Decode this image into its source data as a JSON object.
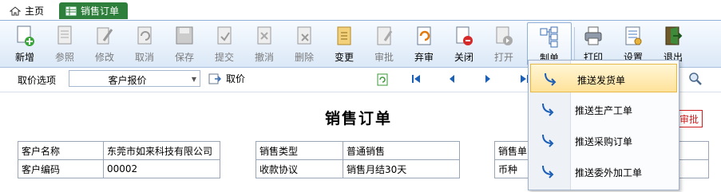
{
  "tabs": {
    "home": "主页",
    "active": "销售订单"
  },
  "toolbar": [
    {
      "key": "add",
      "label": "新增",
      "icon": "new-doc-icon",
      "enabled": true
    },
    {
      "key": "ref",
      "label": "参照",
      "icon": "reference-icon",
      "enabled": false
    },
    {
      "key": "edit",
      "label": "修改",
      "icon": "edit-icon",
      "enabled": false
    },
    {
      "key": "cancel",
      "label": "取消",
      "icon": "undo-icon",
      "enabled": false
    },
    {
      "key": "save",
      "label": "保存",
      "icon": "save-icon",
      "enabled": false
    },
    {
      "key": "submit",
      "label": "提交",
      "icon": "submit-icon",
      "enabled": false
    },
    {
      "key": "withdraw",
      "label": "撤消",
      "icon": "withdraw-icon",
      "enabled": false
    },
    {
      "key": "delete",
      "label": "删除",
      "icon": "delete-icon",
      "enabled": false
    },
    {
      "key": "change",
      "label": "变更",
      "icon": "change-icon",
      "enabled": true
    },
    {
      "key": "approve",
      "label": "审批",
      "icon": "approve-icon",
      "enabled": false
    },
    {
      "key": "unapprove",
      "label": "弃审",
      "icon": "unapprove-icon",
      "enabled": true
    },
    {
      "key": "close",
      "label": "关闭",
      "icon": "close-icon",
      "enabled": true
    },
    {
      "key": "open",
      "label": "打开",
      "icon": "open-icon",
      "enabled": false
    },
    {
      "key": "make",
      "label": "制单",
      "icon": "make-document-icon",
      "enabled": true
    },
    {
      "key": "print",
      "label": "打印",
      "icon": "printer-icon",
      "enabled": true
    },
    {
      "key": "settings",
      "label": "设置",
      "icon": "settings-icon",
      "enabled": true
    },
    {
      "key": "exit",
      "label": "退出",
      "icon": "exit-icon",
      "enabled": true
    }
  ],
  "options": {
    "label": "取价选项",
    "combo_value": "客户报价",
    "get_button": "取价"
  },
  "form": {
    "title": "销售订单",
    "status": "审批",
    "left": [
      {
        "label": "客户名称",
        "value": "东莞市如来科技有限公司"
      },
      {
        "label": "客户编码",
        "value": "00002"
      }
    ],
    "middle": [
      {
        "label": "销售类型",
        "value": "普通销售"
      },
      {
        "label": "收款协议",
        "value": "销售月结30天"
      }
    ],
    "right": [
      {
        "label": "销售单",
        "value": ""
      },
      {
        "label": "币种",
        "value": ""
      }
    ]
  },
  "menu": [
    {
      "label": "推送发货单",
      "highlighted": true
    },
    {
      "label": "推送生产工单",
      "highlighted": false
    },
    {
      "label": "推送采购订单",
      "highlighted": false
    },
    {
      "label": "推送委外加工单",
      "highlighted": false
    }
  ],
  "colors": {
    "active_tab": "#2f7f3c",
    "menu_highlight": "#ffe29a",
    "status_red": "#d01e1e",
    "nav_blue": "#1c5fb7"
  }
}
